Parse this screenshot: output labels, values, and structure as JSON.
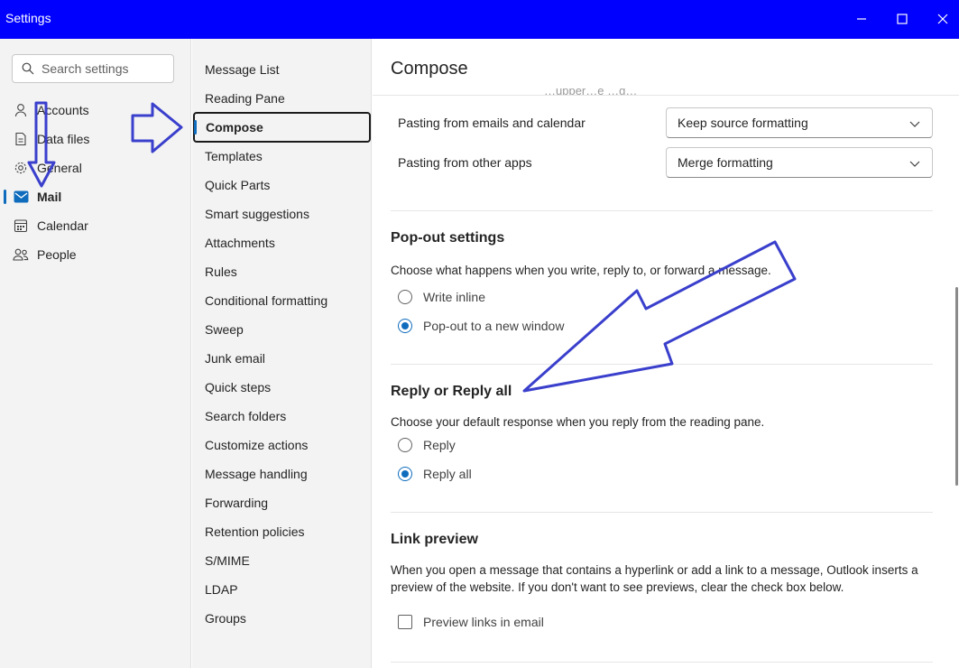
{
  "window": {
    "title": "Settings"
  },
  "search": {
    "placeholder": "Search settings"
  },
  "left_nav": {
    "items": [
      {
        "label": "Accounts",
        "icon": "person-icon"
      },
      {
        "label": "Data files",
        "icon": "document-icon"
      },
      {
        "label": "General",
        "icon": "gear-icon"
      },
      {
        "label": "Mail",
        "icon": "mail-icon",
        "active": true
      },
      {
        "label": "Calendar",
        "icon": "calendar-icon"
      },
      {
        "label": "People",
        "icon": "people-icon"
      }
    ]
  },
  "mail_nav": {
    "items": [
      "Message List",
      "Reading Pane",
      "Compose",
      "Templates",
      "Quick Parts",
      "Smart suggestions",
      "Attachments",
      "Rules",
      "Conditional formatting",
      "Sweep",
      "Junk email",
      "Quick steps",
      "Search folders",
      "Customize actions",
      "Message handling",
      "Forwarding",
      "Retention policies",
      "S/MIME",
      "LDAP",
      "Groups"
    ],
    "active": "Compose"
  },
  "content": {
    "title": "Compose",
    "clipped_text": "…upper…e …g…",
    "pasting": [
      {
        "label": "Pasting from emails and calendar",
        "value": "Keep source formatting"
      },
      {
        "label": "Pasting from other apps",
        "value": "Merge formatting"
      }
    ],
    "popout": {
      "heading": "Pop-out settings",
      "description": "Choose what happens when you write, reply to, or forward a message.",
      "options": [
        "Write inline",
        "Pop-out to a new window"
      ],
      "selected": "Pop-out to a new window"
    },
    "reply": {
      "heading": "Reply or Reply all",
      "description": "Choose your default response when you reply from the reading pane.",
      "options": [
        "Reply",
        "Reply all"
      ],
      "selected": "Reply all"
    },
    "link_preview": {
      "heading": "Link preview",
      "description": "When you open a message that contains a hyperlink or add a link to a message, Outlook inserts a preview of the website. If you don't want to see previews, clear the check box below.",
      "checkbox_label": "Preview links in email",
      "checked": false
    }
  },
  "colors": {
    "titlebar": "#0000ff",
    "accent": "#0f6cbd",
    "annotation_arrow": "#3a3fcc"
  }
}
